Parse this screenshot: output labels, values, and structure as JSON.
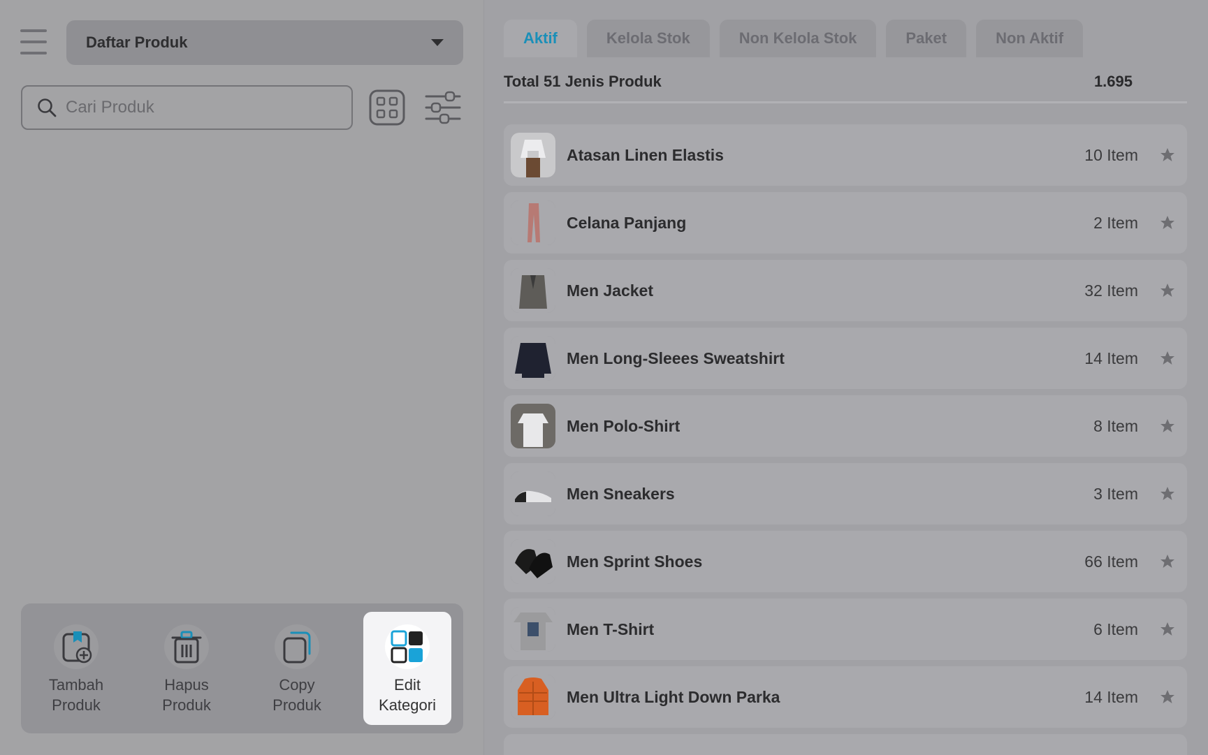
{
  "header": {
    "menu_icon": "hamburger-icon",
    "title": "Daftar Produk"
  },
  "search": {
    "placeholder": "Cari Produk",
    "value": ""
  },
  "actions": [
    {
      "label": "Tambah\nProduk",
      "icon": "add-product-icon"
    },
    {
      "label": "Hapus\nProduk",
      "icon": "trash-icon"
    },
    {
      "label": "Copy\nProduk",
      "icon": "copy-icon"
    },
    {
      "label": "Edit\nKategori",
      "icon": "category-grid-icon",
      "active": true
    }
  ],
  "tabs": [
    {
      "label": "Aktif",
      "active": true
    },
    {
      "label": "Kelola Stok"
    },
    {
      "label": "Non Kelola Stok"
    },
    {
      "label": "Paket"
    },
    {
      "label": "Non Aktif"
    }
  ],
  "summary": {
    "label": "Total 51 Jenis Produk",
    "total": "1.695"
  },
  "products": [
    {
      "name": "Atasan Linen Elastis",
      "qty": "10 Item",
      "thumb": "white-blouse"
    },
    {
      "name": "Celana Panjang",
      "qty": "2 Item",
      "thumb": "pink-pants"
    },
    {
      "name": "Men Jacket",
      "qty": "32 Item",
      "thumb": "grey-blazer"
    },
    {
      "name": "Men Long-Sleees Sweatshirt",
      "qty": "14 Item",
      "thumb": "navy-sweatshirt"
    },
    {
      "name": "Men Polo-Shirt",
      "qty": "8 Item",
      "thumb": "white-polo"
    },
    {
      "name": "Men Sneakers",
      "qty": "3 Item",
      "thumb": "white-sneaker"
    },
    {
      "name": "Men Sprint Shoes",
      "qty": "66 Item",
      "thumb": "black-shoes"
    },
    {
      "name": "Men T-Shirt",
      "qty": "6 Item",
      "thumb": "grey-tshirt"
    },
    {
      "name": "Men Ultra Light Down Parka",
      "qty": "14 Item",
      "thumb": "orange-parka"
    }
  ],
  "colors": {
    "accent": "#1a8fb8",
    "overlay_bg": "#a3a3a5",
    "active_card": "#f4f4f6"
  }
}
